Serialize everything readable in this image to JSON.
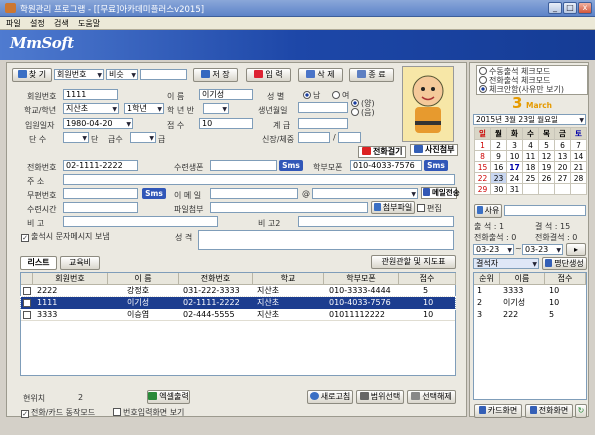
{
  "window": {
    "title": "학원관리 프로그램 - [[무료]아카데미플러스v2015]",
    "minimize": "_",
    "maximize": "□",
    "close": "x"
  },
  "menu": [
    "파일",
    "설정",
    "검색",
    "도움말"
  ],
  "logo": "MmSoft",
  "search": {
    "label": "찾 기",
    "field": "회원번호",
    "op": "비슷",
    "value": ""
  },
  "toolbar": {
    "save": "저 장",
    "input": "입 력",
    "delete": "삭 제",
    "exit": "종 료"
  },
  "form": {
    "member_no_label": "회원번호",
    "member_no": "1111",
    "name_label": "이 름",
    "name": "이기성",
    "gender_label": "성 별",
    "gender_male": "남",
    "gender_female": "여",
    "school_label": "학교/학년",
    "school": "지산초",
    "grade": "1학년",
    "class_label": "학 년 반",
    "birthday_label": "생년월일",
    "solar": "(양)",
    "lunar": "(음)",
    "enroll_label": "입원일자",
    "enroll_date": "1980-04-20",
    "grade2_label": "접 수",
    "grade2": "10",
    "sum_label": "계 급",
    "class2_label": "단 수",
    "class2_suffix": "단",
    "rank_label": "급수",
    "rank_suffix": "급",
    "reg_label": "신장/체중",
    "reg_sep": "/",
    "phone_label": "전화번호",
    "phone": "02-1111-2222",
    "tuition_label": "수련생폰",
    "parent_phone_label": "학부모폰",
    "parent_phone": "010-4033-7576",
    "addr_label": "주 소",
    "no_addr_label": "무편번호",
    "email_label": "이 메 일",
    "email_at": "@",
    "practice_time_label": "수련시간",
    "attach_label": "파일첨부",
    "attach_btn": "첨부파일",
    "edit_btn": "편집",
    "note_label": "비 고",
    "note2_label": "비 고2",
    "sms_check_label": "출석시 문자메시지 보냄",
    "personality_label": "성 격",
    "call_btn": "전화걸기",
    "photo_btn": "사진첨부",
    "mail_btn": "메일전송",
    "sms_btn": "Sms"
  },
  "tabs": {
    "list": "리스트",
    "payment": "교육비"
  },
  "view_btn": "관원관할 및 지도표",
  "table": {
    "headers": [
      "회원번호",
      "이 름",
      "전화번호",
      "학교",
      "학부모폰",
      "접수"
    ],
    "rows": [
      [
        "2222",
        "강정호",
        "031-222-3333",
        "지산초",
        "010-3333-4444",
        "5"
      ],
      [
        "1111",
        "이기성",
        "02-1111-2222",
        "지산초",
        "010-4033-7576",
        "10"
      ],
      [
        "3333",
        "이승엽",
        "02-444-5555",
        "지산초",
        "01011112222",
        "10"
      ]
    ]
  },
  "footer": {
    "current_label": "현위치",
    "current_value": "2",
    "excel_btn": "엑셀출력",
    "refresh_btn": "새로고침",
    "range_btn": "범위선택",
    "select_btn": "선택해제",
    "phone_mode": "전화/카드 동작모드",
    "no_input": "번호입력화면 보기"
  },
  "right": {
    "radio1": "수동출석 체크모드",
    "radio2": "전화출석 체크모드",
    "radio3": "체크안함(사유만 보기)",
    "month_num": "3",
    "month_name": "March",
    "date_value": "2015년  3월 23일 월요일",
    "weekdays": [
      "일",
      "월",
      "화",
      "수",
      "목",
      "금",
      "토"
    ],
    "weeks": [
      [
        "1",
        "2",
        "3",
        "4",
        "5",
        "6",
        "7"
      ],
      [
        "8",
        "9",
        "10",
        "11",
        "12",
        "13",
        "14"
      ],
      [
        "15",
        "16",
        "17",
        "18",
        "19",
        "20",
        "21"
      ],
      [
        "22",
        "23",
        "24",
        "25",
        "26",
        "27",
        "28"
      ],
      [
        "29",
        "30",
        "31",
        "",
        "",
        "",
        ""
      ]
    ],
    "reason_btn": "사유",
    "attend_label": "출 석 : 1",
    "absent_label": "결 석 : 15",
    "phone_attend": "전화출석 : 0",
    "phone_absent": "전화결석 : 0",
    "date_from": "03-23",
    "date_to": "03-23",
    "attend_sel": "결석자",
    "batch_btn": "명단생성",
    "list_headers": [
      "순위",
      "이름",
      "접수"
    ],
    "list_rows": [
      [
        "1",
        "3333",
        "10"
      ],
      [
        "2",
        "이기성",
        "10"
      ],
      [
        "3",
        "222",
        "5"
      ]
    ],
    "card_btn": "카드화면",
    "phone_btn": "전화화면"
  },
  "colors": {
    "banner": "#1d47a8",
    "selected_row": "#1c3d8f",
    "title": "#5d83c8"
  }
}
